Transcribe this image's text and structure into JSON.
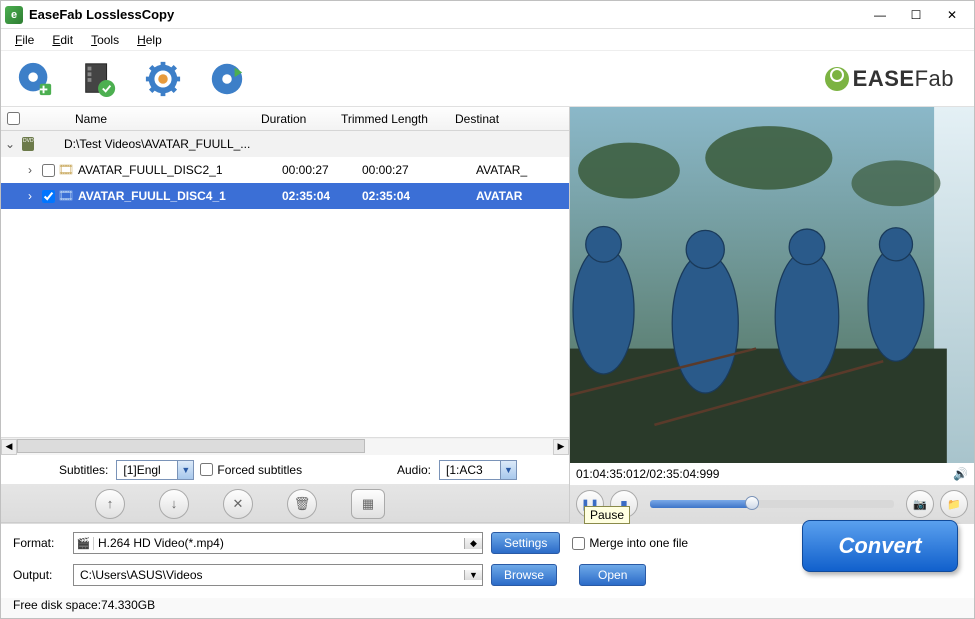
{
  "title": "EaseFab LosslessCopy",
  "menus": {
    "file": "File",
    "edit": "Edit",
    "tools": "Tools",
    "help": "Help"
  },
  "brand": {
    "strong": "EASE",
    "light": "Fab"
  },
  "columns": {
    "name": "Name",
    "duration": "Duration",
    "trimmed": "Trimmed Length",
    "destination": "Destinat"
  },
  "group": {
    "name": "D:\\Test Videos\\AVATAR_FUULL_..."
  },
  "rows": [
    {
      "checked": false,
      "name": "AVATAR_FUULL_DISC2_1",
      "duration": "00:00:27",
      "trimmed": "00:00:27",
      "dest": "AVATAR_",
      "selected": false
    },
    {
      "checked": true,
      "name": "AVATAR_FUULL_DISC4_1",
      "duration": "02:35:04",
      "trimmed": "02:35:04",
      "dest": "AVATAR",
      "selected": true
    }
  ],
  "subtitles": {
    "label": "Subtitles:",
    "value": "[1]Engl"
  },
  "forced": {
    "label": "Forced subtitles"
  },
  "audio": {
    "label": "Audio:",
    "value": "[1:AC3"
  },
  "time": "01:04:35:012/02:35:04:999",
  "tooltip": "Pause",
  "format": {
    "label": "Format:",
    "value": "H.264 HD Video(*.mp4)"
  },
  "settings": "Settings",
  "merge": "Merge into one file",
  "output": {
    "label": "Output:",
    "value": "C:\\Users\\ASUS\\Videos"
  },
  "browse": "Browse",
  "open": "Open",
  "convert": "Convert",
  "free_space": "Free disk space:74.330GB"
}
